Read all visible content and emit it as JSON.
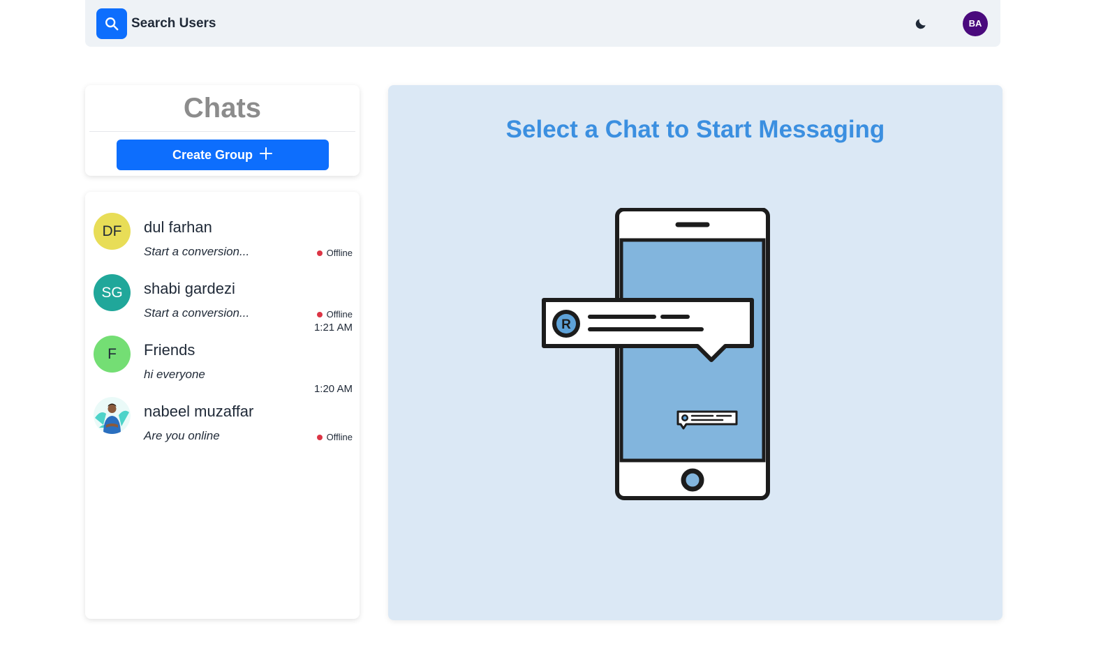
{
  "topbar": {
    "search_label": "Search Users",
    "search_icon": "search-icon",
    "theme_icon": "moon-icon",
    "user_initials": "BA",
    "user_avatar_color": "#4a0a7d",
    "accent_color": "#0d6efd"
  },
  "sidebar": {
    "title": "Chats",
    "create_group_label": "Create Group",
    "create_group_icon": "plus-icon",
    "chats": [
      {
        "initials": "DF",
        "avatar_color": "#e8dd57",
        "name": "dul farhan",
        "preview": "Start a conversion...",
        "status": "Offline",
        "time": ""
      },
      {
        "initials": "SG",
        "avatar_color": "#20a79a",
        "name": "shabi gardezi",
        "preview": "Start a conversion...",
        "status": "Offline",
        "time": ""
      },
      {
        "initials": "F",
        "avatar_color": "#74de74",
        "name": "Friends",
        "preview": "hi everyone",
        "status": "",
        "time": "1:21 AM"
      },
      {
        "initials": "",
        "avatar_color": "#4dd3c9",
        "name": "nabeel muzaffar",
        "preview": "Are you online",
        "status": "Offline",
        "time": "1:20 AM"
      }
    ]
  },
  "main": {
    "placeholder_title": "Select a Chat to Start Messaging",
    "illustration": "phone-chat-illustration",
    "panel_color": "#dbe8f5",
    "title_color": "#3b8fe0"
  }
}
